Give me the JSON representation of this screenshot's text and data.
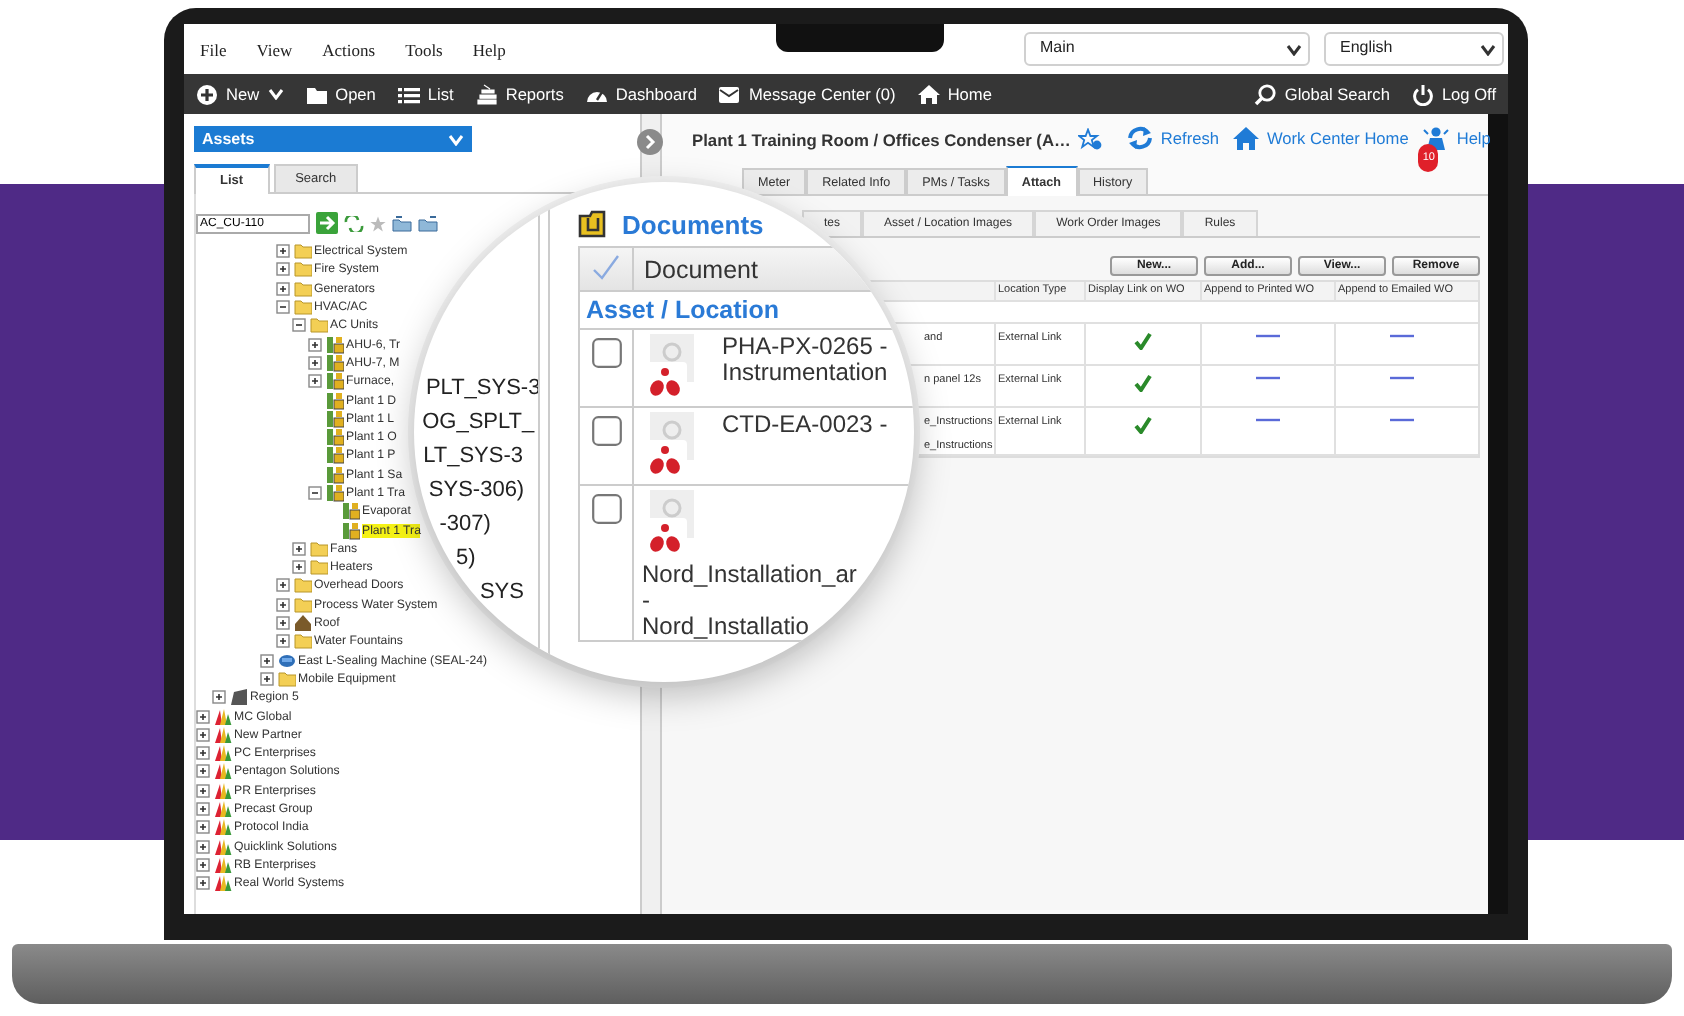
{
  "menu_bar": {
    "items": [
      "File",
      "View",
      "Actions",
      "Tools",
      "Help"
    ],
    "workspace_select": "Main",
    "language_select": "English"
  },
  "toolbar": {
    "left": [
      {
        "kind": "new",
        "label": "New",
        "dropdown": true
      },
      {
        "kind": "open",
        "label": "Open",
        "dropdown": false
      },
      {
        "kind": "list",
        "label": "List",
        "dropdown": false
      },
      {
        "kind": "reports",
        "label": "Reports",
        "dropdown": false
      },
      {
        "kind": "dashboard",
        "label": "Dashboard",
        "dropdown": false
      },
      {
        "kind": "message",
        "label": "Message Center (0)",
        "dropdown": false
      },
      {
        "kind": "home",
        "label": "Home",
        "dropdown": false
      }
    ],
    "right": [
      {
        "kind": "search",
        "label": "Global Search"
      },
      {
        "kind": "logoff",
        "label": "Log Off"
      }
    ]
  },
  "sidebar": {
    "module_select": "Assets",
    "tabs": [
      {
        "label": "List",
        "selected": true
      },
      {
        "label": "Search",
        "selected": false
      }
    ],
    "search_value": "AC_CU-110",
    "tree": [
      {
        "children": [
          {
            "children": [
              {
                "children": [
                  {
                    "children": [
                      {
                        "children": [
                          {
                            "label": "Electrical System",
                            "kind": "folder",
                            "expanded": false,
                            "selected": false
                          },
                          {
                            "label": "Fire System",
                            "kind": "folder",
                            "expanded": false,
                            "selected": false
                          },
                          {
                            "label": "Generators",
                            "kind": "folder",
                            "expanded": false,
                            "selected": false
                          },
                          {
                            "label": "HVAC/AC",
                            "kind": "folder",
                            "expanded": true,
                            "selected": false,
                            "children": [
                              {
                                "label": "AC Units",
                                "kind": "folder",
                                "expanded": true,
                                "selected": false,
                                "children": [
                                  {
                                    "label": "AHU-6, Tr",
                                    "kind": "asset",
                                    "expanded": false,
                                    "selected": false
                                  },
                                  {
                                    "label": "AHU-7, M",
                                    "kind": "asset",
                                    "expanded": false,
                                    "selected": false
                                  },
                                  {
                                    "label": "Furnace,",
                                    "kind": "asset",
                                    "expanded": false,
                                    "selected": false
                                  },
                                  {
                                    "label": "Plant 1 D",
                                    "kind": "asset",
                                    "selected": false
                                  },
                                  {
                                    "label": "Plant 1 L",
                                    "kind": "asset",
                                    "selected": false
                                  },
                                  {
                                    "label": "Plant 1 O",
                                    "kind": "asset",
                                    "selected": false
                                  },
                                  {
                                    "label": "Plant 1 P",
                                    "kind": "asset",
                                    "selected": false
                                  },
                                  {
                                    "label": "Plant 1 Sa",
                                    "kind": "asset",
                                    "selected": false
                                  },
                                  {
                                    "label": "Plant 1 Tra",
                                    "kind": "asset",
                                    "expanded": true,
                                    "selected": false,
                                    "children": [
                                      {
                                        "label": "Evaporat",
                                        "kind": "asset",
                                        "selected": false
                                      },
                                      {
                                        "label": "Plant 1 Tra",
                                        "kind": "asset",
                                        "selected": true
                                      }
                                    ]
                                  }
                                ]
                              },
                              {
                                "label": "Fans",
                                "kind": "folder",
                                "expanded": false,
                                "selected": false
                              },
                              {
                                "label": "Heaters",
                                "kind": "folder",
                                "expanded": false,
                                "selected": false
                              }
                            ]
                          },
                          {
                            "label": "Overhead Doors",
                            "kind": "folder",
                            "expanded": false,
                            "selected": false
                          },
                          {
                            "label": "Process Water System",
                            "kind": "folder",
                            "expanded": false,
                            "selected": false
                          },
                          {
                            "label": "Roof",
                            "kind": "roof",
                            "expanded": false,
                            "selected": false
                          },
                          {
                            "label": "Water Fountains",
                            "kind": "folder",
                            "expanded": false,
                            "selected": false
                          }
                        ]
                      },
                      {
                        "label": "East L-Sealing Machine (SEAL-24)",
                        "kind": "machine",
                        "expanded": false,
                        "selected": false
                      },
                      {
                        "label": "Mobile Equipment",
                        "kind": "folder",
                        "expanded": false,
                        "selected": false
                      }
                    ]
                  }
                ]
              }
            ]
          },
          {
            "label": "Region 5",
            "kind": "region",
            "expanded": false,
            "selected": false
          }
        ]
      },
      {
        "label": "MC Global",
        "kind": "company",
        "expanded": false,
        "selected": false
      },
      {
        "label": "New Partner",
        "kind": "company",
        "expanded": false,
        "selected": false
      },
      {
        "label": "PC Enterprises",
        "kind": "company",
        "expanded": false,
        "selected": false
      },
      {
        "label": "Pentagon Solutions",
        "kind": "company",
        "expanded": false,
        "selected": false
      },
      {
        "label": "PR Enterprises",
        "kind": "company",
        "expanded": false,
        "selected": false
      },
      {
        "label": "Precast Group",
        "kind": "company",
        "expanded": false,
        "selected": false
      },
      {
        "label": "Protocol India",
        "kind": "company",
        "expanded": false,
        "selected": false
      },
      {
        "label": "Quicklink Solutions",
        "kind": "company",
        "expanded": false,
        "selected": false
      },
      {
        "label": "RB Enterprises",
        "kind": "company",
        "expanded": false,
        "selected": false
      },
      {
        "label": "Real World Systems",
        "kind": "company",
        "expanded": false,
        "selected": false
      }
    ]
  },
  "record": {
    "title": "Plant 1 Training Room / Offices Condenser  (A…",
    "actions": [
      {
        "kind": "refresh",
        "label": "Refresh"
      },
      {
        "kind": "home",
        "label": "Work Center Home"
      },
      {
        "kind": "help",
        "label": "Help",
        "badge": "10"
      }
    ],
    "tabs": [
      {
        "label": "Meter",
        "selected": false
      },
      {
        "label": "Related Info",
        "selected": false
      },
      {
        "label": "PMs / Tasks",
        "selected": false
      },
      {
        "label": "Attach",
        "selected": true
      },
      {
        "label": "History",
        "selected": false
      }
    ],
    "subtabs": [
      {
        "label": "tes",
        "selected": false
      },
      {
        "label": "Asset / Location Images",
        "selected": false
      },
      {
        "label": "Work Order Images",
        "selected": false
      },
      {
        "label": "Rules",
        "selected": false
      }
    ],
    "buttons": [
      "New...",
      "Add...",
      "View...",
      "Remove"
    ],
    "table": {
      "columns": [
        "Location Type",
        "Display Link on WO",
        "Append to Printed WO",
        "Append to Emailed WO"
      ],
      "rows": [
        {
          "document": [
            "and"
          ],
          "location_type": "External Link",
          "display_link": true,
          "append_printed": false,
          "append_emailed": false
        },
        {
          "document": [
            "n panel 12s"
          ],
          "location_type": "External Link",
          "display_link": true,
          "append_printed": false,
          "append_emailed": false
        },
        {
          "document": [
            "e_Instructions",
            "e_Instructions"
          ],
          "location_type": "External Link",
          "display_link": true,
          "append_printed": false,
          "append_emailed": false
        }
      ]
    }
  },
  "magnifier": {
    "tree_fragments": [
      "PLT_SYS-3",
      "OG_SPLT_",
      "LT_SYS-3",
      "SYS-306)",
      "-307)",
      "5)",
      "SYS"
    ],
    "panel_title": "Documents",
    "column": "Document",
    "group": "Asset / Location",
    "rows": [
      {
        "checked": false,
        "lines": [
          "PHA-PX-0265 -",
          "Instrumentation"
        ]
      },
      {
        "checked": false,
        "lines": [
          "CTD-EA-0023 -"
        ]
      },
      {
        "checked": false,
        "lines": [
          "Nord_Installation_ar",
          "-",
          "Nord_Installatio"
        ]
      }
    ]
  }
}
